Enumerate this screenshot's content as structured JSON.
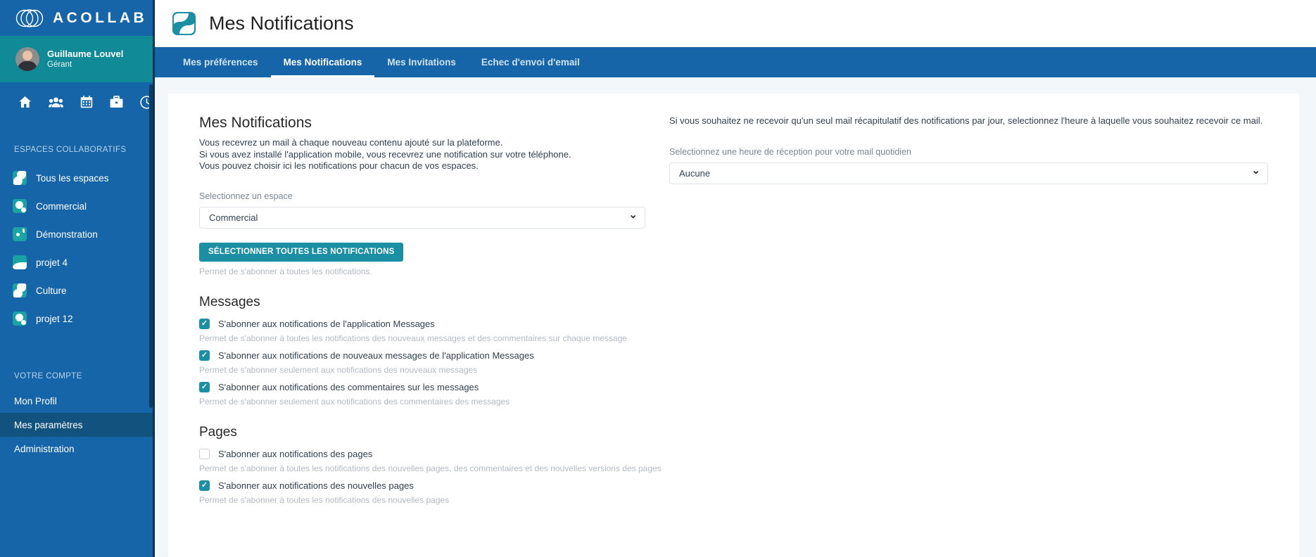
{
  "brand": {
    "name": "ACOLLAB",
    "logo_icon": "acollab-swirl-icon"
  },
  "user": {
    "name": "Guillaume Louvel",
    "role": "Gérant",
    "avatar_icon": "user-avatar"
  },
  "quick_icons": [
    {
      "name": "home-icon",
      "label": "Accueil"
    },
    {
      "name": "users-icon",
      "label": "Utilisateurs"
    },
    {
      "name": "calendar-icon",
      "label": "Agenda"
    },
    {
      "name": "briefcase-icon",
      "label": "Projets"
    },
    {
      "name": "clock-icon",
      "label": "Temps"
    }
  ],
  "sidebar": {
    "spaces_label": "ESPACES COLLABORATIFS",
    "spaces": [
      {
        "label": "Tous les espaces",
        "icon": "space-icon-all"
      },
      {
        "label": "Commercial",
        "icon": "space-icon-commercial"
      },
      {
        "label": "Démonstration",
        "icon": "space-icon-demonstration"
      },
      {
        "label": "projet 4",
        "icon": "space-icon-projet-4"
      },
      {
        "label": "Culture",
        "icon": "space-icon-culture"
      },
      {
        "label": "projet 12",
        "icon": "space-icon-projet-12"
      }
    ],
    "account_label": "VOTRE COMPTE",
    "account_items": [
      {
        "label": "Mon Profil",
        "active": false
      },
      {
        "label": "Mes paramètres",
        "active": true
      },
      {
        "label": "Administration",
        "active": false
      }
    ]
  },
  "header": {
    "title": "Mes Notifications",
    "icon": "page-mark-icon"
  },
  "tabs": [
    {
      "label": "Mes préférences",
      "active": false
    },
    {
      "label": "Mes Notifications",
      "active": true
    },
    {
      "label": "Mes Invitations",
      "active": false
    },
    {
      "label": "Echec d'envoi d'email",
      "active": false
    }
  ],
  "main": {
    "card_title": "Mes Notifications",
    "desc_1": "Vous recevrez un mail à chaque nouveau contenu ajouté sur la plateforme.",
    "desc_2": "Si vous avez installé l'application mobile, vous recevrez une notification sur votre téléphone.",
    "desc_3": "Vous pouvez choisir ici les notifications pour chacun de vos espaces.",
    "space_select_label": "Selectionnez un espace",
    "space_select_value": "Commercial",
    "select_all_button": "SÉLECTIONNER TOUTES LES NOTIFICATIONS",
    "select_all_hint": "Permet de s'abonner à toutes les notifications.",
    "groups": [
      {
        "title": "Messages",
        "options": [
          {
            "label": "S'abonner aux notifications de l'application Messages",
            "hint": "Permet de s'abonner à toutes les notifications des nouveaux messages et des commentaires sur chaque message",
            "checked": true
          },
          {
            "label": "S'abonner aux notifications de nouveaux messages de l'application Messages",
            "hint": "Permet de s'abonner seulement aux notifications des nouveaux messages",
            "checked": true
          },
          {
            "label": "S'abonner aux notifications des commentaires sur les messages",
            "hint": "Permet de s'abonner seulement aux notifications des commentaires des messages",
            "checked": true
          }
        ]
      },
      {
        "title": "Pages",
        "options": [
          {
            "label": "S'abonner aux notifications des pages",
            "hint": "Permet de s'abonner à toutes les notifications des nouvelles pages, des commentaires et des nouvelles versions des pages",
            "checked": false
          },
          {
            "label": "S'abonner aux notifications des nouvelles pages",
            "hint": "Permet de s'abonner à toutes les notifications des nouvelles pages",
            "checked": true
          }
        ]
      }
    ]
  },
  "right": {
    "paragraph": "Si vous souhaitez ne recevoir qu'un seul mail récapitulatif des notifications par jour, selectionnez l'heure à laquelle vous souhaitez recevoir ce mail.",
    "hour_select_label": "Selectionnez une heure de réception pour votre mail quotidien",
    "hour_select_value": "Aucune"
  },
  "colors": {
    "sidebar_blue": "#1565a8",
    "user_teal": "#108a96",
    "accent_teal": "#1b8fa3",
    "space_icon_teal": "#1aa3a3",
    "active_item": "#12527f",
    "page_bg": "#f4f7fa"
  }
}
